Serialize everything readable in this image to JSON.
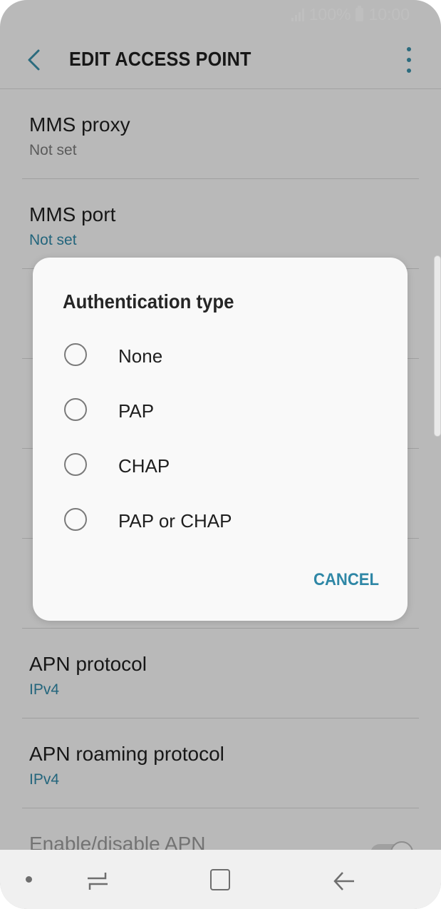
{
  "status_bar": {
    "battery": "100%",
    "time": "10:00"
  },
  "app_bar": {
    "title": "EDIT ACCESS POINT"
  },
  "settings": [
    {
      "title": "MMS proxy",
      "value": "Not set",
      "value_style": "grey"
    },
    {
      "title": "MMS port",
      "value": "Not set",
      "value_style": "blue"
    },
    {
      "title": "",
      "value": "",
      "value_style": "blue"
    },
    {
      "title": "",
      "value": "",
      "value_style": "blue"
    },
    {
      "title": "",
      "value": "",
      "value_style": "blue"
    },
    {
      "title": "",
      "value": "",
      "value_style": "grey"
    },
    {
      "title": "APN protocol",
      "value": "IPv4",
      "value_style": "blue"
    },
    {
      "title": "APN roaming protocol",
      "value": "IPv4",
      "value_style": "blue"
    },
    {
      "title": "Enable/disable APN",
      "value": "",
      "value_style": "grey"
    }
  ],
  "dialog": {
    "title": "Authentication type",
    "options": [
      "None",
      "PAP",
      "CHAP",
      "PAP or CHAP"
    ],
    "selected": null,
    "cancel_label": "CANCEL"
  },
  "colors": {
    "accent": "#2f87a6",
    "dialog_bg": "#f9f9f9"
  },
  "icons": {
    "back": "chevron-left-icon",
    "more": "more-vert-icon",
    "nav_recents": "recents-icon",
    "nav_home": "home-icon",
    "nav_back": "back-arrow-icon"
  }
}
